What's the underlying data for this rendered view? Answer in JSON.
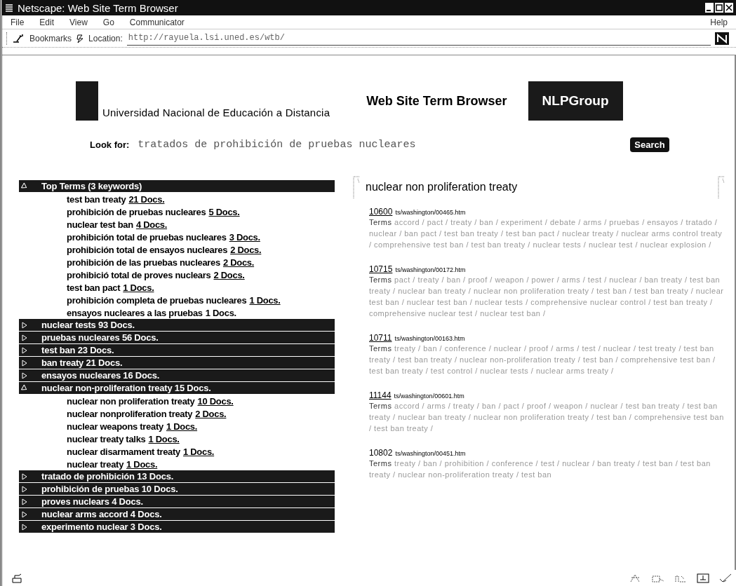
{
  "window": {
    "title": "Netscape: Web Site Term Browser"
  },
  "menu": [
    {
      "label": "File"
    },
    {
      "label": "Edit"
    },
    {
      "label": "View"
    },
    {
      "label": "Go"
    },
    {
      "label": "Communicator"
    }
  ],
  "help_menu": "Help",
  "toolbar": {
    "bookmarks": "Bookmarks",
    "location_label": "Location:",
    "location": "http://rayuela.lsi.uned.es/wtb/"
  },
  "header": {
    "university": "Universidad Nacional de Educación a Distancia",
    "title": "Web Site Term Browser",
    "group": "NLPGroup"
  },
  "search": {
    "label": "Look for:",
    "value": "tratados de prohibición de pruebas nucleares",
    "button": "Search"
  },
  "tree": [
    {
      "label": "Top Terms (3 keywords)",
      "expanded": true,
      "children": [
        {
          "term": "test ban treaty",
          "docs": "21 Docs.",
          "linked": true
        },
        {
          "term": "prohibición de pruebas nucleares",
          "docs": "5 Docs.",
          "linked": true
        },
        {
          "term": "nuclear test ban",
          "docs": "4 Docs.",
          "linked": true
        },
        {
          "term": "prohibición total de pruebas nucleares",
          "docs": "3 Docs.",
          "linked": true
        },
        {
          "term": "prohibición total de ensayos nucleares",
          "docs": "2 Docs.",
          "linked": true
        },
        {
          "term": "prohibición de las pruebas nucleares",
          "docs": "2 Docs.",
          "linked": true
        },
        {
          "term": "prohibició total de proves nuclears",
          "docs": "2 Docs.",
          "linked": true
        },
        {
          "term": "test ban pact",
          "docs": "1 Docs.",
          "linked": true
        },
        {
          "term": "prohibición completa de pruebas nucleares",
          "docs": "1 Docs.",
          "linked": true
        },
        {
          "term": "ensayos nucleares a las pruebas",
          "docs": "1 Docs.",
          "linked": false
        }
      ]
    },
    {
      "label": "nuclear tests 93 Docs.",
      "expanded": false
    },
    {
      "label": "pruebas nucleares 56 Docs.",
      "expanded": false
    },
    {
      "label": "test ban 23 Docs.",
      "expanded": false
    },
    {
      "label": "ban treaty 21 Docs.",
      "expanded": false
    },
    {
      "label": "ensayos nucleares 16 Docs.",
      "expanded": false
    },
    {
      "label": "nuclear non-proliferation treaty 15 Docs.",
      "expanded": true,
      "children": [
        {
          "term": "nuclear non  proliferation treaty",
          "docs": "10 Docs.",
          "linked": true
        },
        {
          "term": "nuclear nonproliferation treaty",
          "docs": "2 Docs.",
          "linked": true
        },
        {
          "term": "nuclear weapons treaty",
          "docs": "1 Docs.",
          "linked": true
        },
        {
          "term": "nuclear treaty talks",
          "docs": "1 Docs.",
          "linked": true
        },
        {
          "term": "nuclear disarmament treaty",
          "docs": "1 Docs.",
          "linked": true
        },
        {
          "term": "nuclear treaty",
          "docs": "1 Docs.",
          "linked": true
        }
      ]
    },
    {
      "label": "tratado de prohibición 13 Docs.",
      "expanded": false
    },
    {
      "label": "prohibición de pruebas 10 Docs.",
      "expanded": false
    },
    {
      "label": "proves nuclears 4 Docs.",
      "expanded": false
    },
    {
      "label": "nuclear arms accord 4 Docs.",
      "expanded": false
    },
    {
      "label": "experimento nuclear 3 Docs.",
      "expanded": false
    }
  ],
  "results": {
    "heading": "nuclear non  proliferation treaty",
    "items": [
      {
        "id": "10600",
        "path": "ts/washington/00465.htm",
        "terms_label": "Terms",
        "terms": "accord / pact / treaty / ban / experiment / debate / arms / pruebas / ensayos / tratado / nuclear / ban pact / test ban treaty / test ban pact / nuclear treaty / nuclear arms control treaty / comprehensive test ban / test ban treaty / nuclear tests / nuclear test / nuclear explosion /",
        "linked": true
      },
      {
        "id": "10715",
        "path": "ts/washington/00172.htm",
        "terms_label": "Terms",
        "terms": "pact / treaty / ban / proof / weapon / power / arms / test / nuclear / ban treaty / test ban treaty / nuclear ban treaty / nuclear non  proliferation treaty / test ban / test ban treaty / nuclear test ban / nuclear test ban / nuclear tests / comprehensive nuclear control / test ban treaty / comprehensive nuclear test / nuclear test ban /",
        "linked": true
      },
      {
        "id": "10711",
        "path": "ts/washington/00163.htm",
        "terms_label": "Terms",
        "terms": "treaty / ban / conference / nuclear / proof / arms / test / nuclear / test treaty / test ban treaty / test ban treaty / nuclear non-proliferation treaty / test ban / comprehensive test ban / test ban treaty / test control / nuclear tests / nuclear arms treaty /",
        "linked": true
      },
      {
        "id": "11144",
        "path": "ts/washington/00601.htm",
        "terms_label": "Terms",
        "terms": "accord / arms / treaty / ban / pact / proof / weapon / nuclear / test ban treaty / test ban treaty / nuclear ban treaty / nuclear non  proliferation treaty / test ban / comprehensive test ban / test ban treaty /",
        "linked": true
      },
      {
        "id": "10802",
        "path": "ts/washington/00451.htm",
        "terms_label": "Terms",
        "terms": "treaty / ban / prohibition / conference / test / nuclear / ban treaty / test ban / test ban treaty / nuclear non-proliferation treaty / test ban",
        "linked": false
      }
    ]
  }
}
